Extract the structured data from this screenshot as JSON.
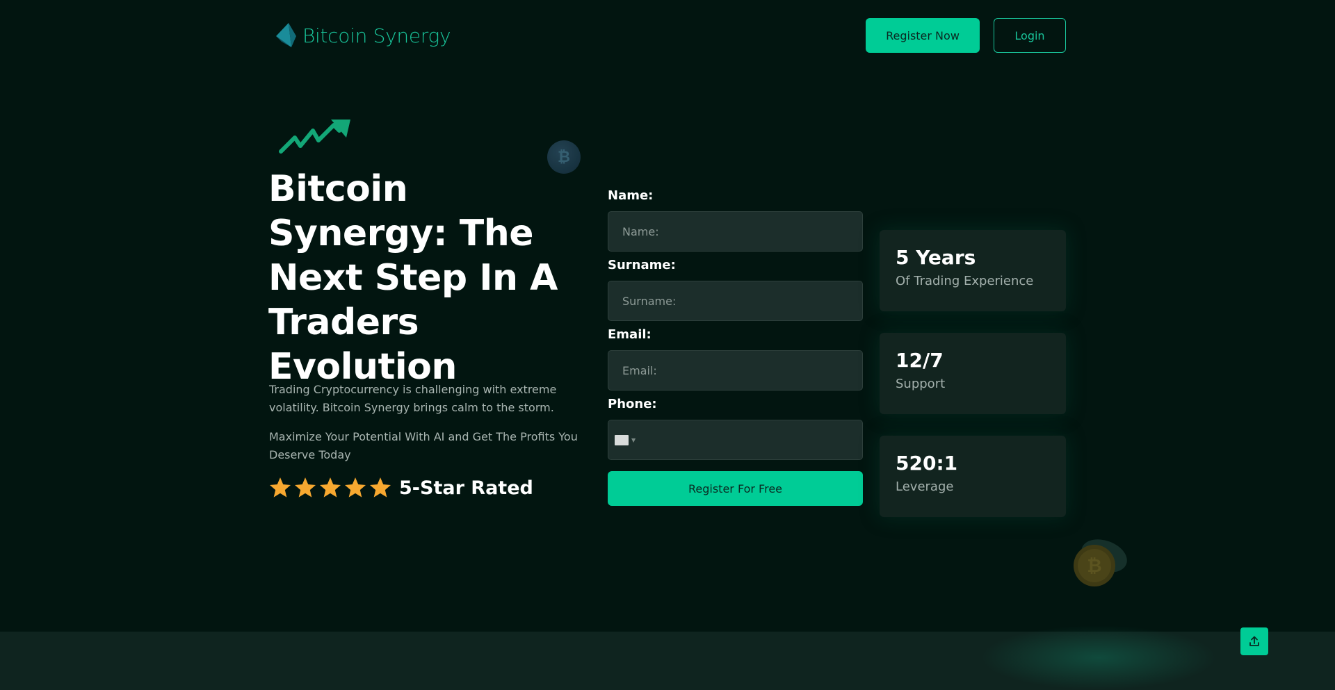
{
  "brand": {
    "name": "Bitcoin Synergy",
    "accent": "#00cc96"
  },
  "header": {
    "register_now": "Register Now",
    "login": "Login"
  },
  "hero": {
    "title": "Bitcoin Synergy: The Next Step In A Traders Evolution",
    "description": "Trading Cryptocurrency is challenging with extreme volatility. Bitcoin Synergy brings calm to the storm.",
    "description2": "Maximize Your Potential With AI and Get The Profits You Deserve Today",
    "rating": {
      "stars": 5,
      "label": "5-Star Rated"
    }
  },
  "form": {
    "name_label": "Name:",
    "name_placeholder": "Name:",
    "surname_label": "Surname:",
    "surname_placeholder": "Surname:",
    "email_label": "Email:",
    "email_placeholder": "Email:",
    "phone_label": "Phone:",
    "submit": "Register For Free"
  },
  "stats": [
    {
      "value": "5 Years",
      "label": "Of Trading Experience"
    },
    {
      "value": "12/7",
      "label": "Support"
    },
    {
      "value": "520:1",
      "label": "Leverage"
    }
  ],
  "icons": {
    "logo": "logo-icon",
    "trend": "trend-arrow-icon",
    "coin": "bitcoin-coin-icon",
    "star": "star-icon",
    "flag": "flag-icon",
    "scroll_top": "upload-arrow-icon"
  }
}
